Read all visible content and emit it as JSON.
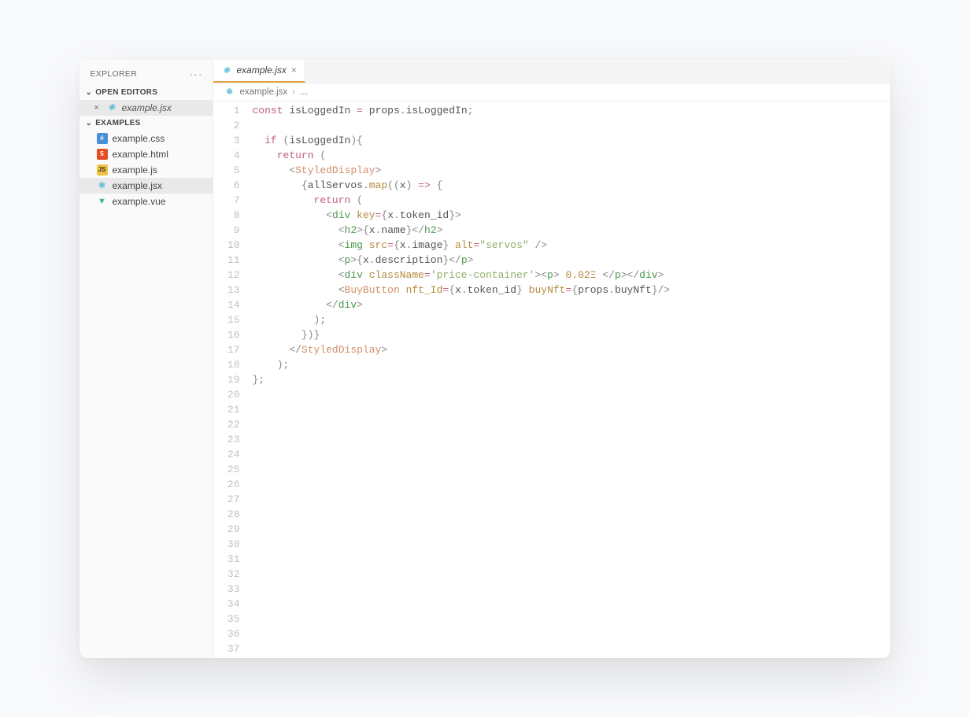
{
  "sidebar": {
    "title": "EXPLORER",
    "sections": {
      "open_editors": {
        "label": "OPEN EDITORS",
        "items": [
          {
            "name": "example.jsx",
            "icon": "react"
          }
        ]
      },
      "examples": {
        "label": "EXAMPLES",
        "items": [
          {
            "name": "example.css",
            "icon": "css"
          },
          {
            "name": "example.html",
            "icon": "html"
          },
          {
            "name": "example.js",
            "icon": "js"
          },
          {
            "name": "example.jsx",
            "icon": "react",
            "active": true
          },
          {
            "name": "example.vue",
            "icon": "vue"
          }
        ]
      }
    }
  },
  "tabs": {
    "active": {
      "name": "example.jsx",
      "icon": "react"
    }
  },
  "breadcrumb": {
    "file": "example.jsx",
    "rest": "..."
  },
  "editor": {
    "total_lines": 37,
    "code_tokens": [
      [
        [
          "kw",
          "const"
        ],
        [
          "",
          " "
        ],
        [
          "var",
          "isLoggedIn"
        ],
        [
          "",
          " "
        ],
        [
          "op",
          "="
        ],
        [
          "",
          " "
        ],
        [
          "var",
          "props"
        ],
        [
          "punc",
          "."
        ],
        [
          "var",
          "isLoggedIn"
        ],
        [
          "punc",
          ";"
        ]
      ],
      [],
      [
        [
          "",
          "  "
        ],
        [
          "kw",
          "if"
        ],
        [
          "",
          " "
        ],
        [
          "punc",
          "("
        ],
        [
          "var",
          "isLoggedIn"
        ],
        [
          "punc",
          ")"
        ],
        [
          "punc",
          "{"
        ]
      ],
      [
        [
          "",
          "    "
        ],
        [
          "kw",
          "return"
        ],
        [
          "",
          " "
        ],
        [
          "punc",
          "("
        ]
      ],
      [
        [
          "",
          "      "
        ],
        [
          "punc",
          "<"
        ],
        [
          "comp",
          "StyledDisplay"
        ],
        [
          "punc",
          ">"
        ]
      ],
      [
        [
          "",
          "        "
        ],
        [
          "punc",
          "{"
        ],
        [
          "var",
          "allServos"
        ],
        [
          "punc",
          "."
        ],
        [
          "fn",
          "map"
        ],
        [
          "punc",
          "(("
        ],
        [
          "var",
          "x"
        ],
        [
          "punc",
          ")"
        ],
        [
          "",
          " "
        ],
        [
          "op",
          "=>"
        ],
        [
          "",
          " "
        ],
        [
          "punc",
          "{"
        ]
      ],
      [
        [
          "",
          "          "
        ],
        [
          "kw",
          "return"
        ],
        [
          "",
          " "
        ],
        [
          "punc",
          "("
        ]
      ],
      [
        [
          "",
          "            "
        ],
        [
          "punc",
          "<"
        ],
        [
          "tag",
          "div"
        ],
        [
          "",
          " "
        ],
        [
          "attr",
          "key"
        ],
        [
          "op",
          "="
        ],
        [
          "punc",
          "{"
        ],
        [
          "var",
          "x"
        ],
        [
          "punc",
          "."
        ],
        [
          "var",
          "token_id"
        ],
        [
          "punc",
          "}"
        ],
        [
          "punc",
          ">"
        ]
      ],
      [
        [
          "",
          "              "
        ],
        [
          "punc",
          "<"
        ],
        [
          "tag",
          "h2"
        ],
        [
          "punc",
          ">"
        ],
        [
          "punc",
          "{"
        ],
        [
          "var",
          "x"
        ],
        [
          "punc",
          "."
        ],
        [
          "var",
          "name"
        ],
        [
          "punc",
          "}"
        ],
        [
          "punc",
          "</"
        ],
        [
          "tag",
          "h2"
        ],
        [
          "punc",
          ">"
        ]
      ],
      [
        [
          "",
          "              "
        ],
        [
          "punc",
          "<"
        ],
        [
          "tag",
          "img"
        ],
        [
          "",
          " "
        ],
        [
          "attr",
          "src"
        ],
        [
          "op",
          "="
        ],
        [
          "punc",
          "{"
        ],
        [
          "var",
          "x"
        ],
        [
          "punc",
          "."
        ],
        [
          "var",
          "image"
        ],
        [
          "punc",
          "}"
        ],
        [
          "",
          " "
        ],
        [
          "attr",
          "alt"
        ],
        [
          "op",
          "="
        ],
        [
          "str",
          "\"servos\""
        ],
        [
          "",
          " "
        ],
        [
          "punc",
          "/>"
        ]
      ],
      [
        [
          "",
          "              "
        ],
        [
          "punc",
          "<"
        ],
        [
          "tag",
          "p"
        ],
        [
          "punc",
          ">"
        ],
        [
          "punc",
          "{"
        ],
        [
          "var",
          "x"
        ],
        [
          "punc",
          "."
        ],
        [
          "var",
          "description"
        ],
        [
          "punc",
          "}"
        ],
        [
          "punc",
          "</"
        ],
        [
          "tag",
          "p"
        ],
        [
          "punc",
          ">"
        ]
      ],
      [
        [
          "",
          "              "
        ],
        [
          "punc",
          "<"
        ],
        [
          "tag",
          "div"
        ],
        [
          "",
          " "
        ],
        [
          "attr",
          "className"
        ],
        [
          "op",
          "="
        ],
        [
          "str",
          "'price-container'"
        ],
        [
          "punc",
          ">"
        ],
        [
          "punc",
          "<"
        ],
        [
          "tag",
          "p"
        ],
        [
          "punc",
          ">"
        ],
        [
          "",
          " "
        ],
        [
          "num",
          "0.02Ξ"
        ],
        [
          "",
          " "
        ],
        [
          "punc",
          "</"
        ],
        [
          "tag",
          "p"
        ],
        [
          "punc",
          ">"
        ],
        [
          "punc",
          "</"
        ],
        [
          "tag",
          "div"
        ],
        [
          "punc",
          ">"
        ]
      ],
      [
        [
          "",
          "              "
        ],
        [
          "punc",
          "<"
        ],
        [
          "comp",
          "BuyButton"
        ],
        [
          "",
          " "
        ],
        [
          "attr",
          "nft_Id"
        ],
        [
          "op",
          "="
        ],
        [
          "punc",
          "{"
        ],
        [
          "var",
          "x"
        ],
        [
          "punc",
          "."
        ],
        [
          "var",
          "token_id"
        ],
        [
          "punc",
          "}"
        ],
        [
          "",
          " "
        ],
        [
          "attr",
          "buyNft"
        ],
        [
          "op",
          "="
        ],
        [
          "punc",
          "{"
        ],
        [
          "var",
          "props"
        ],
        [
          "punc",
          "."
        ],
        [
          "var",
          "buyNft"
        ],
        [
          "punc",
          "}"
        ],
        [
          "punc",
          "/>"
        ]
      ],
      [
        [
          "",
          "            "
        ],
        [
          "punc",
          "</"
        ],
        [
          "tag",
          "div"
        ],
        [
          "punc",
          ">"
        ]
      ],
      [
        [
          "",
          "          "
        ],
        [
          "punc",
          ");"
        ]
      ],
      [
        [
          "",
          "        "
        ],
        [
          "punc",
          "})}"
        ]
      ],
      [
        [
          "",
          "      "
        ],
        [
          "punc",
          "</"
        ],
        [
          "comp",
          "StyledDisplay"
        ],
        [
          "punc",
          ">"
        ]
      ],
      [
        [
          "",
          "    "
        ],
        [
          "punc",
          ");"
        ]
      ],
      [
        [
          "punc",
          "};"
        ]
      ]
    ]
  },
  "colors": {
    "accent_tab": "#e6a23c",
    "react": "#4fb6d6",
    "vue": "#41b883",
    "html": "#e44d26",
    "css": "#4a90d9",
    "js": "#f0c040"
  }
}
